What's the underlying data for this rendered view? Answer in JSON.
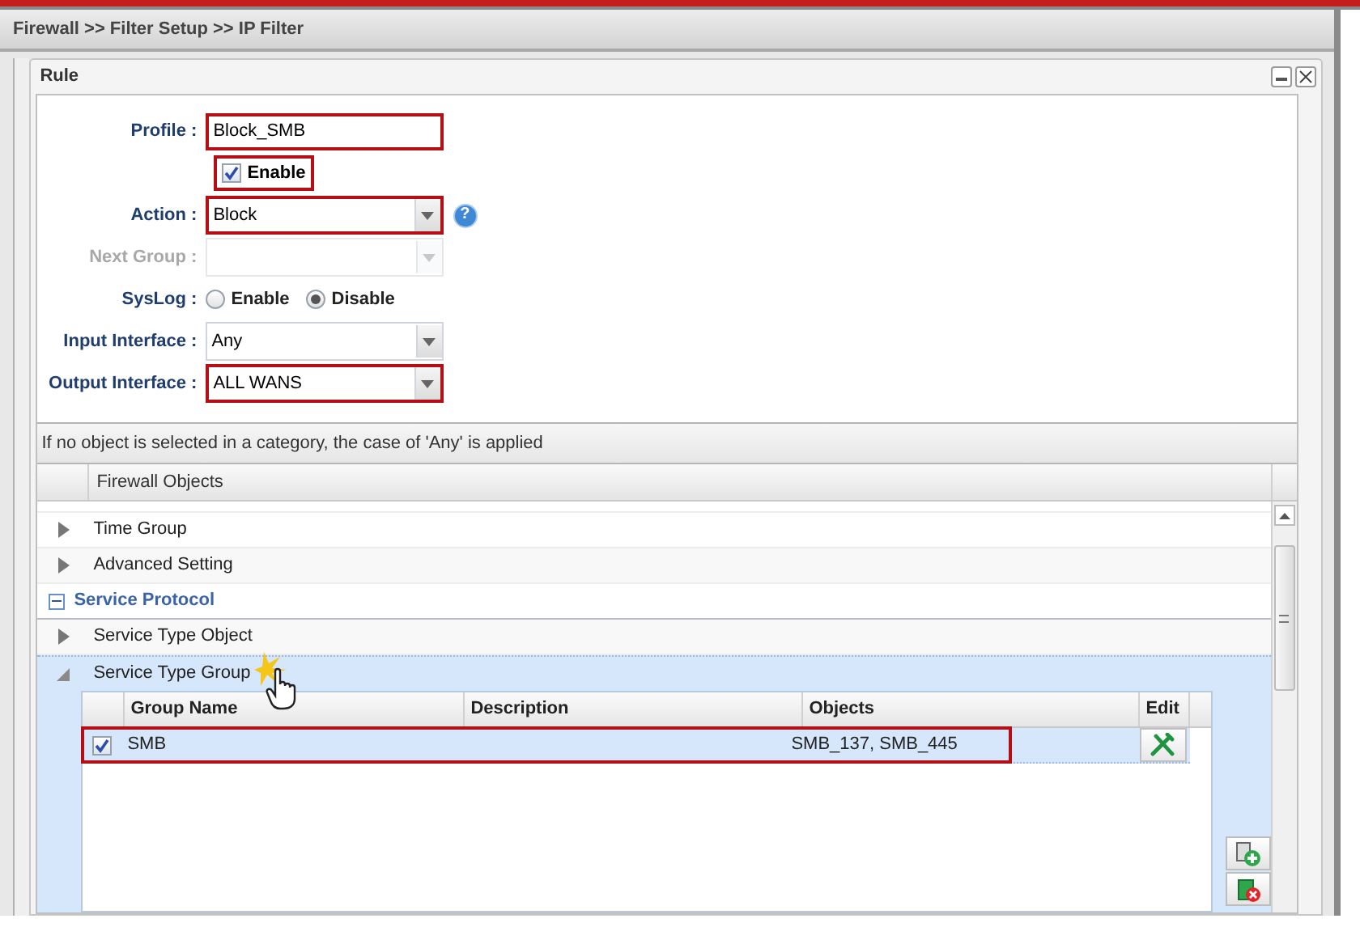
{
  "breadcrumb": "Firewall >> Filter Setup >> IP Filter",
  "window": {
    "title": "Rule"
  },
  "fields": [
    {
      "kind": "text",
      "label": "Profile :",
      "value": "Block_SMB",
      "highlighted": true
    },
    {
      "kind": "checkbox",
      "label": "Enable",
      "checked": true,
      "highlighted": true
    },
    {
      "kind": "select",
      "label": "Action :",
      "value": "Block",
      "highlighted": true,
      "disabled": false,
      "help": "?"
    },
    {
      "kind": "select",
      "label": "Next Group :",
      "highlighted": false,
      "disabled": true
    },
    {
      "kind": "radio",
      "label": "SysLog :",
      "options": [
        {
          "label": "Enable",
          "selected": false
        },
        {
          "label": "Disable",
          "selected": true
        }
      ]
    },
    {
      "kind": "select",
      "label": "Input Interface :",
      "value": "Any",
      "highlighted": false,
      "disabled": false
    },
    {
      "kind": "select",
      "label": "Output Interface :",
      "value": "ALL WANS",
      "highlighted": true,
      "disabled": false
    }
  ],
  "notice": "If no object is selected in a category, the case of 'Any' is applied",
  "objects": {
    "header": "Firewall Objects",
    "items": [
      {
        "kind": "item",
        "label": "Time Group",
        "expanded": false
      },
      {
        "kind": "item",
        "label": "Advanced Setting",
        "expanded": false
      },
      {
        "kind": "category",
        "label": "Service Protocol",
        "expanded": true
      },
      {
        "kind": "item",
        "label": "Service Type Object",
        "expanded": false
      },
      {
        "kind": "item",
        "label": "Service Type Group",
        "expanded": true
      }
    ],
    "table": {
      "columns": [
        "Group Name",
        "Description",
        "Objects",
        "Edit"
      ],
      "rows": [
        {
          "group_name": "SMB",
          "objects": "SMB_137, SMB_445",
          "checked": true,
          "highlighted": true
        }
      ]
    }
  }
}
